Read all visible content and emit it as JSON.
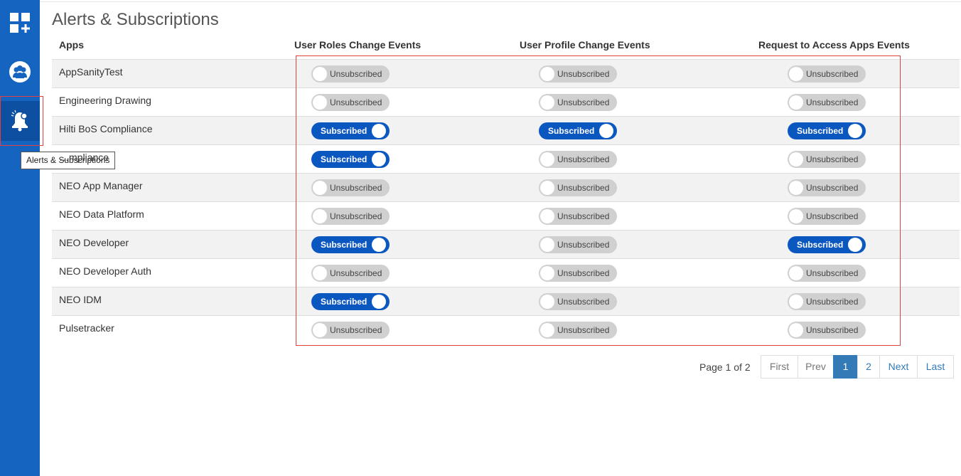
{
  "sidebar": {
    "items": [
      {
        "name": "apps",
        "icon": "apps-add-icon"
      },
      {
        "name": "users",
        "icon": "users-group-icon"
      },
      {
        "name": "alerts",
        "icon": "bell-icon",
        "active": true
      }
    ],
    "tooltip": "Alerts & Subscriptions"
  },
  "page": {
    "title": "Alerts & Subscriptions"
  },
  "table": {
    "headers": {
      "apps": "Apps",
      "roles": "User Roles Change Events",
      "profile": "User Profile Change Events",
      "access": "Request to Access Apps Events"
    },
    "subscribed_label": "Subscribed",
    "unsubscribed_label": "Unsubscribed",
    "rows": [
      {
        "app": "AppSanityTest",
        "roles": "Unsubscribed",
        "profile": "Unsubscribed",
        "access": "Unsubscribed"
      },
      {
        "app": "Engineering Drawing",
        "roles": "Unsubscribed",
        "profile": "Unsubscribed",
        "access": "Unsubscribed"
      },
      {
        "app": "Hilti BoS Compliance",
        "roles": "Subscribed",
        "profile": "Subscribed",
        "access": "Subscribed"
      },
      {
        "app": "…mpliance",
        "roles": "Subscribed",
        "profile": "Unsubscribed",
        "access": "Unsubscribed"
      },
      {
        "app": "NEO App Manager",
        "roles": "Unsubscribed",
        "profile": "Unsubscribed",
        "access": "Unsubscribed"
      },
      {
        "app": "NEO Data Platform",
        "roles": "Unsubscribed",
        "profile": "Unsubscribed",
        "access": "Unsubscribed"
      },
      {
        "app": "NEO Developer",
        "roles": "Subscribed",
        "profile": "Unsubscribed",
        "access": "Subscribed"
      },
      {
        "app": "NEO Developer Auth",
        "roles": "Unsubscribed",
        "profile": "Unsubscribed",
        "access": "Unsubscribed"
      },
      {
        "app": "NEO IDM",
        "roles": "Subscribed",
        "profile": "Unsubscribed",
        "access": "Unsubscribed"
      },
      {
        "app": "Pulsetracker",
        "roles": "Unsubscribed",
        "profile": "Unsubscribed",
        "access": "Unsubscribed"
      }
    ]
  },
  "pagination": {
    "info": "Page 1 of 2",
    "first": "First",
    "prev": "Prev",
    "pages": [
      "1",
      "2"
    ],
    "current": "1",
    "next": "Next",
    "last": "Last"
  },
  "colors": {
    "sidebar": "#1565c0",
    "toggle_on": "#0b57c0",
    "toggle_off": "#d0d0d0",
    "highlight": "#e04040",
    "link": "#337ab7"
  }
}
